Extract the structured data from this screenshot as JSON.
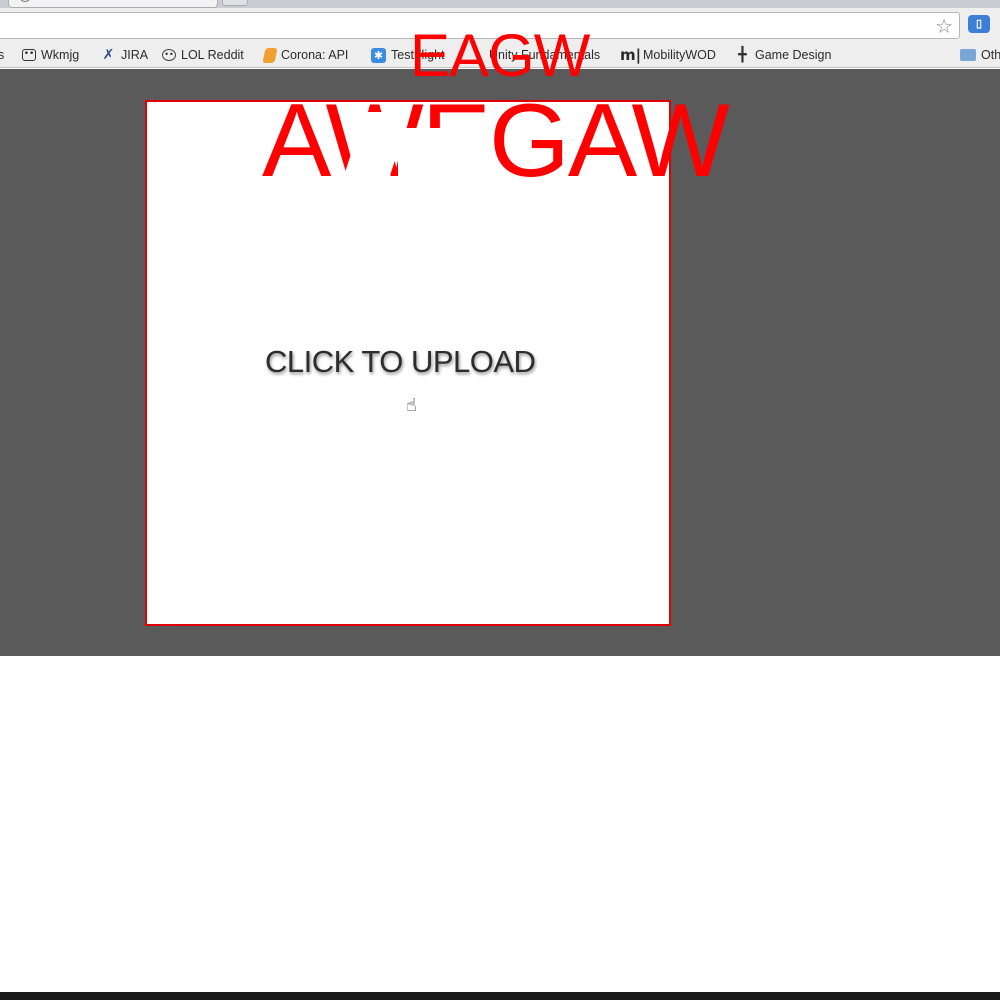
{
  "bookmarks": {
    "items": [
      {
        "label": "s",
        "icon": "none"
      },
      {
        "label": "Wkmjg",
        "icon": "robot-icon"
      },
      {
        "label": "JIRA",
        "icon": "jira-icon"
      },
      {
        "label": "LOL Reddit",
        "icon": "reddit-icon"
      },
      {
        "label": "Corona: API",
        "icon": "corona-icon"
      },
      {
        "label": "TestFlight",
        "icon": "testflight-icon"
      },
      {
        "label": "Unity Fundamentals",
        "icon": "none"
      },
      {
        "label": "MobilityWOD",
        "icon": "mobility-icon"
      },
      {
        "label": "Game Design",
        "icon": "game-design-icon"
      },
      {
        "label": "Oth",
        "icon": "folder-icon"
      }
    ]
  },
  "page": {
    "title_small": "EAGW",
    "title_large": "AWEGAW",
    "upload_label": "CLICK TO UPLOAD"
  },
  "colors": {
    "accent": "#ff0000",
    "page_background": "#5a5a5a",
    "upload_border": "#e00000"
  }
}
